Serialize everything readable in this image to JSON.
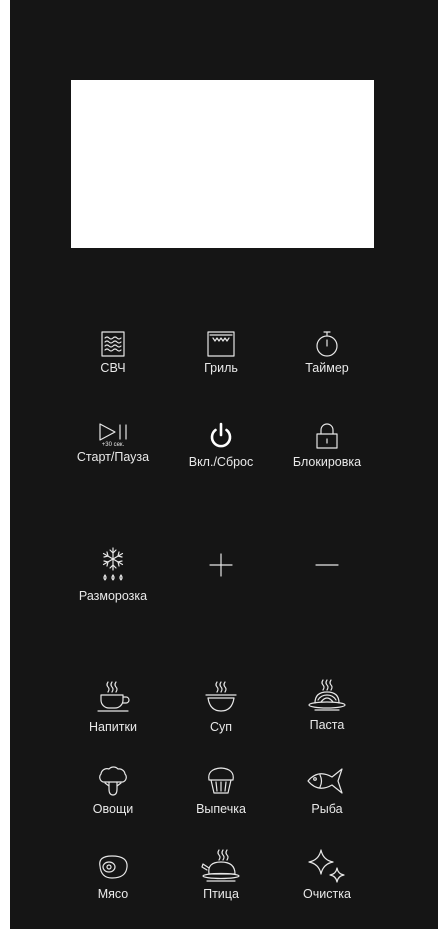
{
  "buttons": {
    "microwave": "СВЧ",
    "grill": "Гриль",
    "timer": "Таймер",
    "start_pause": "Старт/Пауза",
    "start_pause_sub": "+30 сек.",
    "power_reset": "Вкл./Сброс",
    "lock": "Блокировка",
    "defrost": "Разморозка"
  },
  "programs": {
    "drinks": "Напитки",
    "soup": "Суп",
    "pasta": "Паста",
    "vegetables": "Овощи",
    "baking": "Выпечка",
    "fish": "Рыба",
    "meat": "Мясо",
    "poultry": "Птица",
    "cleaning": "Очистка"
  },
  "colors": {
    "panel": "#151515",
    "text": "#e9e9e9",
    "display": "#ffffff"
  }
}
